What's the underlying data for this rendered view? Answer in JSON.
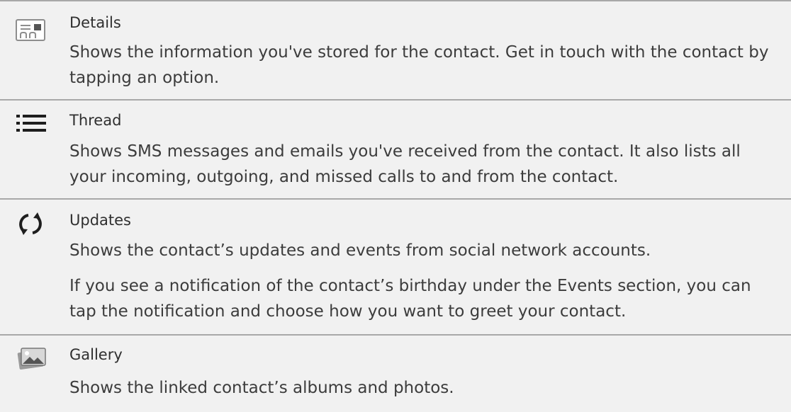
{
  "sections": [
    {
      "icon": "details-card-icon",
      "title": "Details",
      "paragraphs": [
        "Shows the information you've stored for the contact. Get in touch with the contact by tapping an option."
      ]
    },
    {
      "icon": "list-icon",
      "title": "Thread",
      "paragraphs": [
        "Shows SMS messages and emails you've received from the contact. It also lists all your incoming, outgoing, and missed calls to and from the contact."
      ]
    },
    {
      "icon": "refresh-icon",
      "title": "Updates",
      "paragraphs": [
        "Shows the contact’s updates and events from social network accounts.",
        "If you see a notification of the contact’s birthday under the Events section, you can tap the notification and choose how you want to greet your contact."
      ]
    },
    {
      "icon": "gallery-icon",
      "title": "Gallery",
      "paragraphs": [
        "Shows the linked contact’s albums and photos."
      ]
    }
  ],
  "colors": {
    "background": "#f1f1f1",
    "divider": "#a8a8a8",
    "text": "#3c3c3c",
    "icon_dark": "#1e1e1e",
    "icon_gray": "#8e8e8e"
  }
}
